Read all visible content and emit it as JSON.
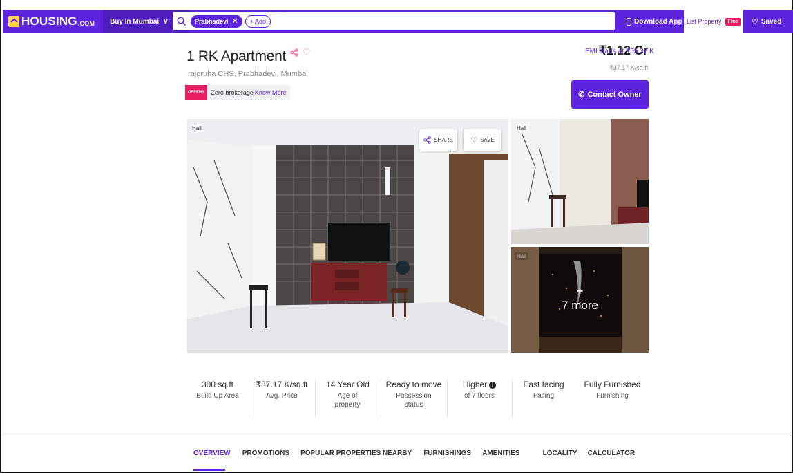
{
  "header": {
    "logo_text": "HOUSING",
    "logo_suffix": ".COM",
    "city_label": "Buy In Mumbai",
    "search_chip": "Prabhadevi",
    "add_label": "+ Add",
    "download_app": "Download App",
    "list_property": "List Property",
    "free_badge": "Free",
    "saved": "Saved"
  },
  "listing": {
    "title": "1 RK Apartment",
    "address": "rajgruha CHS, Prabhadevi, Mumbai",
    "offers_tag": "OFFERS",
    "offer_text": "Zero brokerage",
    "offer_link": "Know More",
    "price": "₹1.12 Cr",
    "emi": "EMI starts at ₹55.36 K",
    "price_per_sqft": "₹37.17 K/sq.ft",
    "contact_button": "Contact Owner"
  },
  "gallery": {
    "main_tag": "Hall",
    "share": "SHARE",
    "save": "SAVE",
    "side1_tag": "Hall",
    "side2_tag": "Hall",
    "more_plus": "+",
    "more_text": "7 more"
  },
  "facts": [
    {
      "value": "300 sq.ft",
      "label": "Build Up Area"
    },
    {
      "value": "₹37.17 K/sq.ft",
      "label": "Avg. Price"
    },
    {
      "value": "14 Year Old",
      "label": "Age of property"
    },
    {
      "value": "Ready to move",
      "label": "Possession status"
    },
    {
      "value": "Higher",
      "label": "of 7 floors"
    },
    {
      "value": "East facing",
      "label": "Facing"
    },
    {
      "value": "Fully Furnished",
      "label": "Furnishing"
    }
  ],
  "tabs": [
    "OVERVIEW",
    "PROMOTIONS",
    "POPULAR PROPERTIES NEARBY",
    "FURNISHINGS",
    "AMENITIES",
    "LOCALITY",
    "CALCULATOR"
  ],
  "colors": {
    "brand": "#5e23dc",
    "accent": "#e91e63"
  }
}
